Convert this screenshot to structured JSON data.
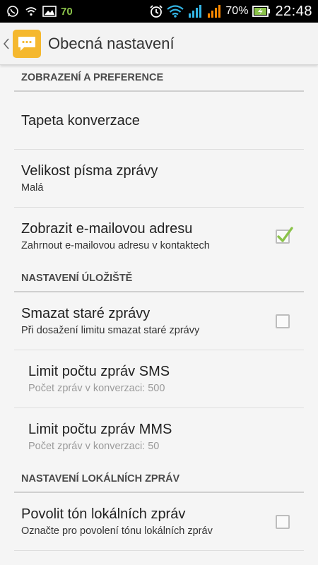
{
  "status_bar": {
    "notification_count": "70",
    "battery_percent": "70%",
    "time": "22:48",
    "icons": [
      "whatsapp-icon",
      "wifi-small-icon",
      "gallery-icon",
      "alarm-icon",
      "wifi-icon",
      "signal-blue-icon",
      "signal-orange-icon",
      "battery-charging-icon"
    ],
    "colors": {
      "background": "#000000",
      "wifi": "#33b5e5",
      "signal_blue": "#33b5e5",
      "signal_orange": "#ff8800",
      "count": "#8bc34a"
    }
  },
  "action_bar": {
    "title": "Obecná nastavení",
    "icons": [
      "back-chevron-icon",
      "messaging-app-icon"
    ],
    "app_icon_color": "#f5b82e"
  },
  "sections": [
    {
      "header": "ZOBRAZENÍ A PREFERENCE",
      "items": [
        {
          "title": "Tapeta konverzace"
        },
        {
          "title": "Velikost písma zprávy",
          "summary": "Malá"
        },
        {
          "title": "Zobrazit e-mailovou adresu",
          "summary": "Zahrnout e-mailovou adresu v kontaktech",
          "checked": true
        }
      ]
    },
    {
      "header": "NASTAVENÍ ÚLOŽIŠTĚ",
      "items": [
        {
          "title": "Smazat staré zprávy",
          "summary": "Při dosažení limitu smazat staré zprávy",
          "checked": false
        },
        {
          "title": "Limit počtu zpráv SMS",
          "summary": "Počet zpráv v konverzaci: 500",
          "disabled": true
        },
        {
          "title": "Limit počtu zpráv MMS",
          "summary": "Počet zpráv v konverzaci: 50",
          "disabled": true
        }
      ]
    },
    {
      "header": "NASTAVENÍ LOKÁLNÍCH ZPRÁV",
      "items": [
        {
          "title": "Povolit tón lokálních zpráv",
          "summary": "Označte pro povolení tónu lokálních zpráv",
          "checked": false
        }
      ]
    }
  ],
  "accent_color": "#8bc34a"
}
